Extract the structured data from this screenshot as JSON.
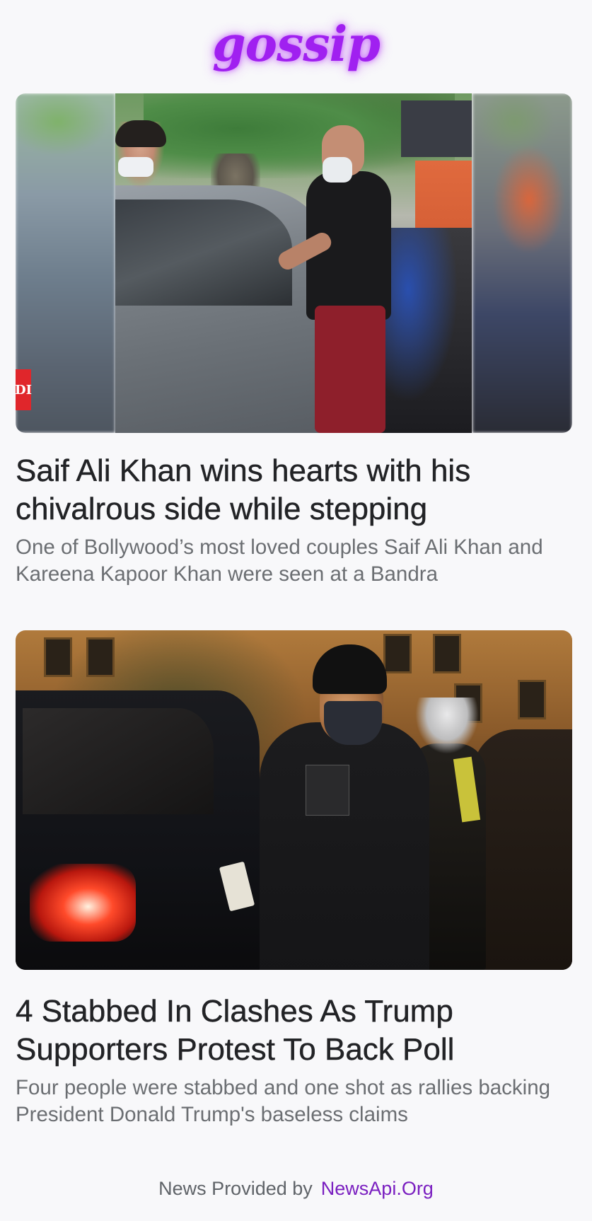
{
  "app": {
    "logo_text": "gossip",
    "logo_color": "#a020f0"
  },
  "articles": [
    {
      "image_label": "photo-saif-ali-khan",
      "badge_text": "DI",
      "title": "Saif Ali Khan wins hearts with his chivalrous side while stepping",
      "description": "One of Bollywood’s most loved couples Saif Ali Khan and Kareena Kapoor Khan were seen at a Bandra"
    },
    {
      "image_label": "photo-trump-supporters-protest",
      "title": "4 Stabbed In Clashes As Trump Supporters Protest To Back Poll",
      "description": "Four people were stabbed and one shot as rallies backing President Donald Trump's baseless claims"
    }
  ],
  "footer": {
    "label": "News Provided by",
    "link_text": "NewsApi.Org",
    "link_color": "#7a1fc0"
  }
}
